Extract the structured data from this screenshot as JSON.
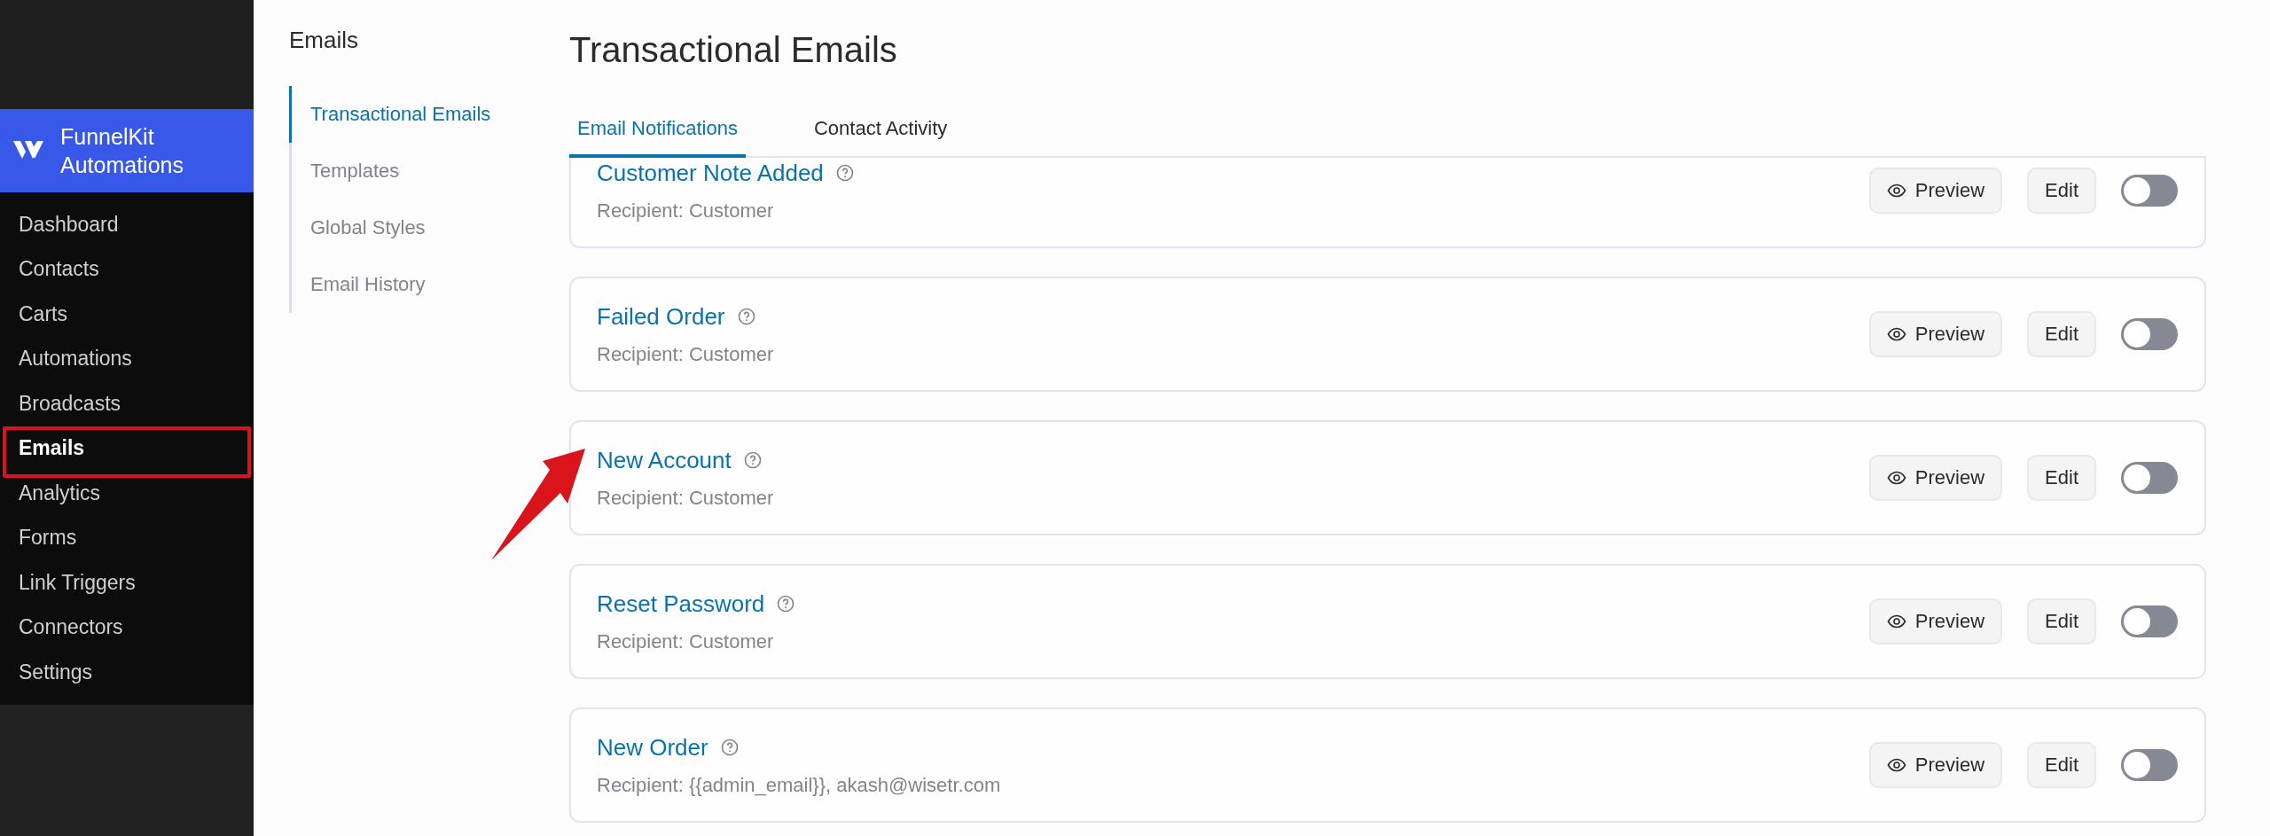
{
  "sidebar": {
    "brand": "FunnelKit Automations",
    "items": [
      {
        "label": "Dashboard",
        "selected": false,
        "highlighted": false
      },
      {
        "label": "Contacts",
        "selected": false,
        "highlighted": false
      },
      {
        "label": "Carts",
        "selected": false,
        "highlighted": false
      },
      {
        "label": "Automations",
        "selected": false,
        "highlighted": false
      },
      {
        "label": "Broadcasts",
        "selected": false,
        "highlighted": false
      },
      {
        "label": "Emails",
        "selected": true,
        "highlighted": true
      },
      {
        "label": "Analytics",
        "selected": false,
        "highlighted": false
      },
      {
        "label": "Forms",
        "selected": false,
        "highlighted": false
      },
      {
        "label": "Link Triggers",
        "selected": false,
        "highlighted": false
      },
      {
        "label": "Connectors",
        "selected": false,
        "highlighted": false
      },
      {
        "label": "Settings",
        "selected": false,
        "highlighted": false
      }
    ]
  },
  "submenu": {
    "heading": "Emails",
    "items": [
      {
        "label": "Transactional Emails",
        "selected": true
      },
      {
        "label": "Templates",
        "selected": false
      },
      {
        "label": "Global Styles",
        "selected": false
      },
      {
        "label": "Email History",
        "selected": false
      }
    ]
  },
  "page_title": "Transactional Emails",
  "tabs": [
    {
      "label": "Email Notifications",
      "selected": true
    },
    {
      "label": "Contact Activity",
      "selected": false
    }
  ],
  "emails": [
    {
      "title": "Customer Note Added",
      "recipient": "Recipient: Customer",
      "preview": "Preview",
      "edit": "Edit",
      "enabled": false,
      "pointed": false
    },
    {
      "title": "Failed Order",
      "recipient": "Recipient: Customer",
      "preview": "Preview",
      "edit": "Edit",
      "enabled": false,
      "pointed": false
    },
    {
      "title": "New Account",
      "recipient": "Recipient: Customer",
      "preview": "Preview",
      "edit": "Edit",
      "enabled": false,
      "pointed": true
    },
    {
      "title": "Reset Password",
      "recipient": "Recipient: Customer",
      "preview": "Preview",
      "edit": "Edit",
      "enabled": false,
      "pointed": false
    },
    {
      "title": "New Order",
      "recipient": "Recipient: {{admin_email}}, akash@wisetr.com",
      "preview": "Preview",
      "edit": "Edit",
      "enabled": false,
      "pointed": false
    }
  ]
}
